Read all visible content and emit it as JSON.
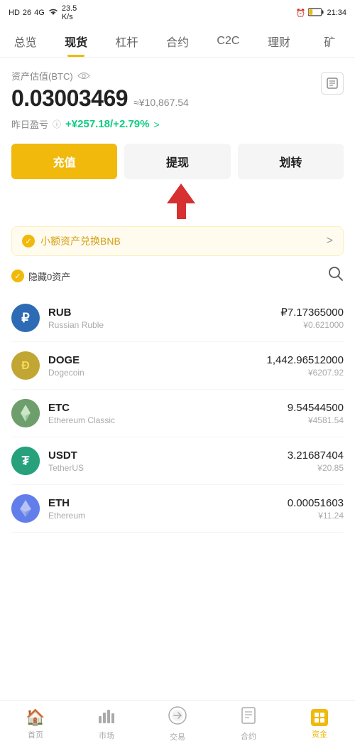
{
  "statusBar": {
    "left": "HD  26  46  23.5 K/s",
    "time": "21:34",
    "battery": "20"
  },
  "nav": {
    "items": [
      {
        "id": "overview",
        "label": "总览"
      },
      {
        "id": "spot",
        "label": "现货"
      },
      {
        "id": "leverage",
        "label": "杠杆"
      },
      {
        "id": "contract",
        "label": "合约"
      },
      {
        "id": "c2c",
        "label": "C2C"
      },
      {
        "id": "finance",
        "label": "理财"
      },
      {
        "id": "mining",
        "label": "矿"
      }
    ],
    "activeIndex": 1
  },
  "portfolio": {
    "assetLabel": "资产估值(BTC)",
    "btcAmount": "0.03003469",
    "cnyApprox": "≈¥10,867.54",
    "pnlLabel": "昨日盈亏",
    "pnlValue": "+¥257.18/+2.79%",
    "pnlArrow": ">"
  },
  "actions": {
    "deposit": "充值",
    "withdraw": "提现",
    "transfer": "划转"
  },
  "bnbBanner": {
    "text": "小额资产兑换BNB",
    "arrow": ">"
  },
  "assetListHeader": {
    "hideLabel": "隐藏0资产",
    "searchLabel": "搜索"
  },
  "coins": [
    {
      "id": "rub",
      "symbol": "RUB",
      "name": "Russian Ruble",
      "amount": "₽7.17365000",
      "cny": "¥0.621000",
      "iconType": "rub",
      "iconChar": "₽"
    },
    {
      "id": "doge",
      "symbol": "DOGE",
      "name": "Dogecoin",
      "amount": "1,442.96512000",
      "cny": "¥6207.92",
      "iconType": "doge",
      "iconChar": "Ð"
    },
    {
      "id": "etc",
      "symbol": "ETC",
      "name": "Ethereum Classic",
      "amount": "9.54544500",
      "cny": "¥4581.54",
      "iconType": "etc",
      "iconChar": "◆"
    },
    {
      "id": "usdt",
      "symbol": "USDT",
      "name": "TetherUS",
      "amount": "3.21687404",
      "cny": "¥20.85",
      "iconType": "usdt",
      "iconChar": "₮"
    },
    {
      "id": "eth",
      "symbol": "ETH",
      "name": "Ethereum",
      "amount": "0.00051603",
      "cny": "¥11.24",
      "iconType": "eth",
      "iconChar": "⬡"
    }
  ],
  "bottomNav": {
    "items": [
      {
        "id": "home",
        "label": "首页",
        "icon": "🏠"
      },
      {
        "id": "market",
        "label": "市场",
        "icon": "📊"
      },
      {
        "id": "trade",
        "label": "交易",
        "icon": "🔄"
      },
      {
        "id": "contract",
        "label": "合约",
        "icon": "📋"
      },
      {
        "id": "assets",
        "label": "资金",
        "icon": "💰"
      }
    ],
    "activeIndex": 4
  }
}
